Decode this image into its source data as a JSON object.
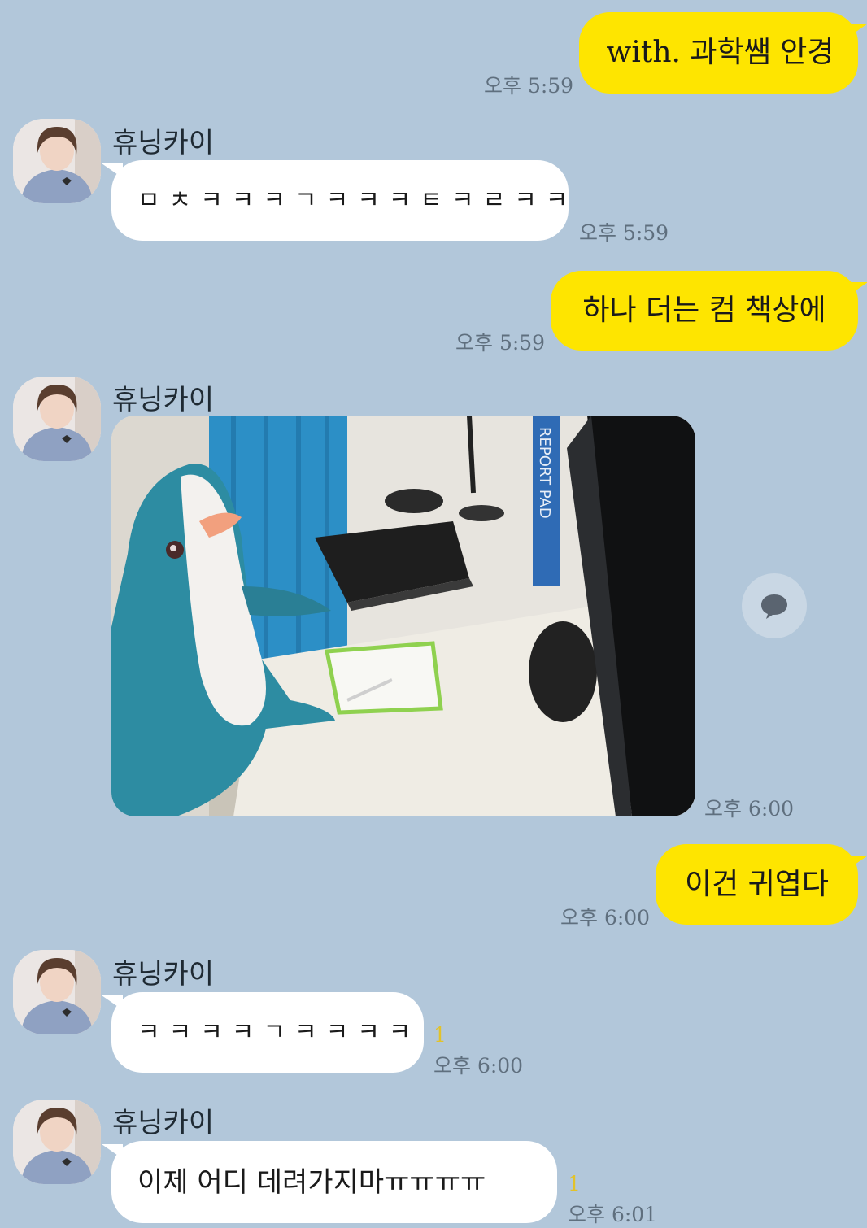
{
  "contact_name": "휴닝카이",
  "colors": {
    "background": "#b2c7da",
    "sent_bubble": "#fee500",
    "received_bubble": "#ffffff",
    "unread_count": "#e2c22a"
  },
  "messages": [
    {
      "from": "me",
      "text": "with. 과학쌤 안경",
      "time": "오후 5:59"
    },
    {
      "from": "contact",
      "sender": "휴닝카이",
      "text": "ㅁㅊㅋㅋㅋㄱㅋㅋㅋㅌㅋㄹㅋㅋ",
      "time": "오후 5:59"
    },
    {
      "from": "me",
      "text": "하나 더는 컴 책상에",
      "time": "오후 5:59"
    },
    {
      "from": "contact",
      "sender": "휴닝카이",
      "type": "photo",
      "time": "오후 6:00",
      "photo_label_text": "REPORT PAD"
    },
    {
      "from": "me",
      "text": "이건 귀엽다",
      "time": "오후 6:00"
    },
    {
      "from": "contact",
      "sender": "휴닝카이",
      "text": "ㅋㅋㅋㅋㄱㅋㅋㅋㅋ",
      "time": "오후 6:00",
      "unread": "1"
    },
    {
      "from": "contact",
      "sender": "휴닝카이",
      "text": "이제 어디 데려가지마ㅠㅠㅠㅠ",
      "time": "오후 6:01",
      "unread": "1"
    }
  ],
  "icons": {
    "reply": "speech-bubble-icon",
    "avatar": "profile-avatar-icon"
  }
}
